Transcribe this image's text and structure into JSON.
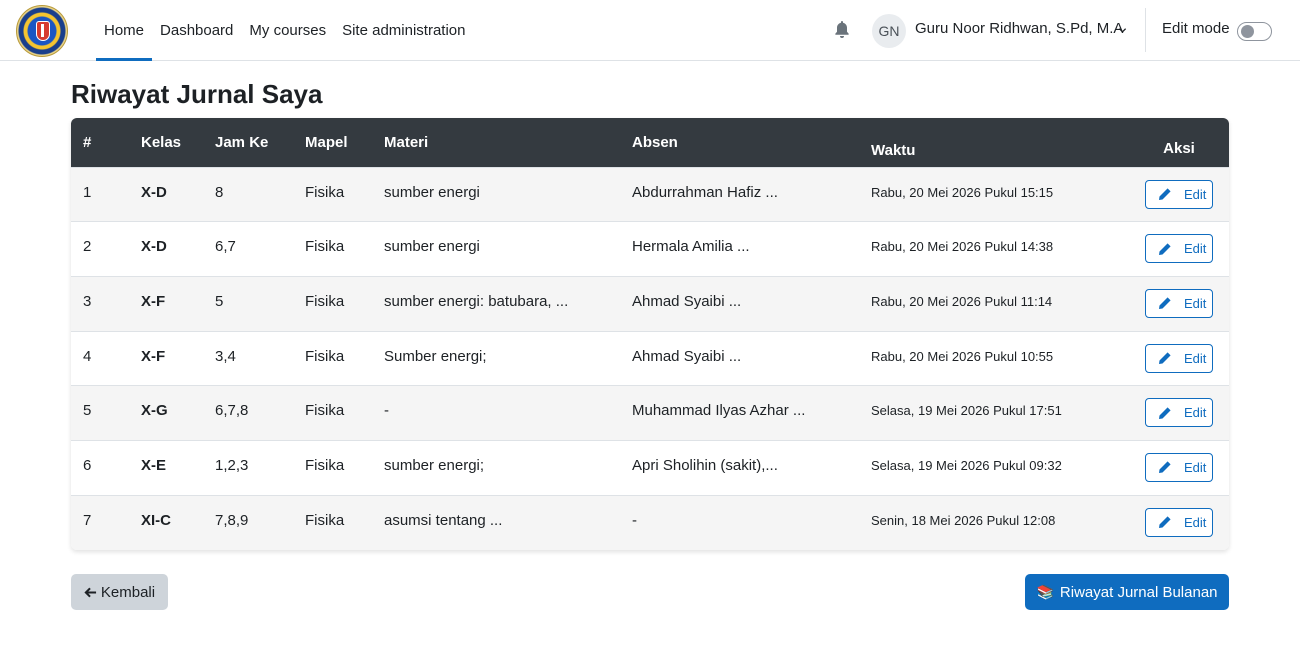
{
  "nav": {
    "logo_name": "school-logo",
    "links": [
      "Home",
      "Dashboard",
      "My courses",
      "Site administration"
    ],
    "active": "Home",
    "user_initials": "GN",
    "user_name": "Guru Noor Ridhwan, S.Pd, M.A",
    "edit_mode_label": "Edit mode",
    "edit_mode_on": false
  },
  "page": {
    "title": "Riwayat Jurnal Saya"
  },
  "table": {
    "headers": [
      "#",
      "Kelas",
      "Jam Ke",
      "Mapel",
      "Materi",
      "Absen",
      "Waktu",
      "Aksi"
    ],
    "rows": [
      {
        "no": "1",
        "kelas": "X-D",
        "jam": "8",
        "mapel": "Fisika",
        "materi": "sumber energi",
        "absen": "Abdurrahman Hafiz ...",
        "waktu": "Rabu, 20 Mei 2026 Pukul 15:15",
        "aksi": "Edit"
      },
      {
        "no": "2",
        "kelas": "X-D",
        "jam": "6,7",
        "mapel": "Fisika",
        "materi": "sumber energi",
        "absen": "Hermala Amilia ...",
        "waktu": "Rabu, 20 Mei 2026 Pukul 14:38",
        "aksi": "Edit"
      },
      {
        "no": "3",
        "kelas": "X-F",
        "jam": "5",
        "mapel": "Fisika",
        "materi": "sumber energi: batubara, ...",
        "absen": "Ahmad Syaibi ...",
        "waktu": "Rabu, 20 Mei 2026 Pukul 11:14",
        "aksi": "Edit"
      },
      {
        "no": "4",
        "kelas": "X-F",
        "jam": "3,4",
        "mapel": "Fisika",
        "materi": "Sumber energi;",
        "absen": "Ahmad Syaibi ...",
        "waktu": "Rabu, 20 Mei 2026 Pukul 10:55",
        "aksi": "Edit"
      },
      {
        "no": "5",
        "kelas": "X-G",
        "jam": "6,7,8",
        "mapel": "Fisika",
        "materi": "-",
        "absen": "Muhammad Ilyas Azhar ...",
        "waktu": "Selasa, 19 Mei 2026 Pukul 17:51",
        "aksi": "Edit"
      },
      {
        "no": "6",
        "kelas": "X-E",
        "jam": "1,2,3",
        "mapel": "Fisika",
        "materi": "sumber energi;",
        "absen": "Apri Sholihin (sakit),...",
        "waktu": "Selasa, 19 Mei 2026 Pukul 09:32",
        "aksi": "Edit"
      },
      {
        "no": "7",
        "kelas": "XI-C",
        "jam": "7,8,9",
        "mapel": "Fisika",
        "materi": "asumsi tentang ...",
        "absen": "-",
        "waktu": "Senin, 18 Mei 2026 Pukul 12:08",
        "aksi": "Edit"
      }
    ]
  },
  "footer": {
    "back_label": "Kembali",
    "history_label": "Riwayat Jurnal Bulanan",
    "history_icon": "📚"
  },
  "colors": {
    "primary": "#0f6cbf",
    "header_bg": "#343a40",
    "back_bg": "#ced4da"
  }
}
